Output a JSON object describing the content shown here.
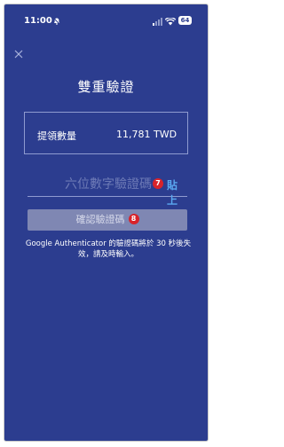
{
  "status_bar": {
    "time": "11:00",
    "battery": "64"
  },
  "header": {
    "title": "雙重驗證"
  },
  "amount_card": {
    "label": "提領數量",
    "value": "1​1,781 TWD"
  },
  "code_field": {
    "placeholder": "六位數字驗證碼",
    "badge": "7",
    "paste_label": "貼上"
  },
  "confirm": {
    "label": "確認驗證碼",
    "badge": "8"
  },
  "note": "Google Authenticator 的驗證碼將於 30 秒後失效，請及時輸入。",
  "colors": {
    "background": "#2c3d8f",
    "accent": "#5aa8f0",
    "badge": "#d8232a",
    "button_disabled": "#7f87b3"
  },
  "icons": [
    "bell-icon",
    "signal-icon",
    "wifi-icon",
    "battery-icon",
    "close-icon"
  ]
}
